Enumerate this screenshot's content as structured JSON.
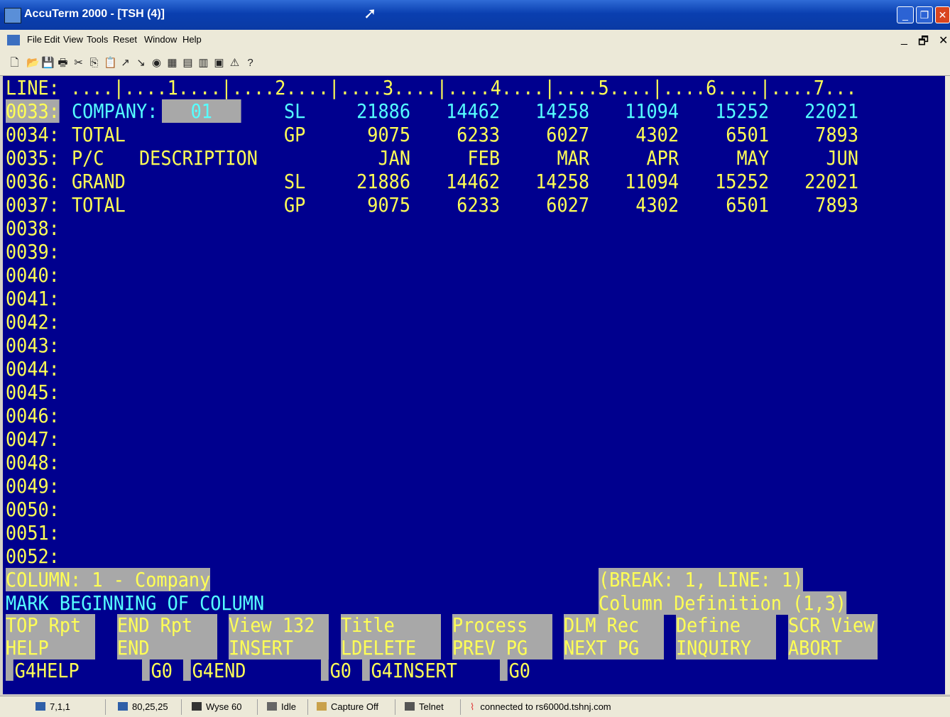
{
  "window": {
    "title": "AccuTerm 2000 - [TSH (4)]",
    "buttons": {
      "minimize": "_",
      "restore": "❐",
      "close": "✕"
    }
  },
  "menu": {
    "items": [
      "File",
      "Edit",
      "View",
      "Tools",
      "Reset",
      "Window",
      "Help"
    ],
    "mdi": {
      "minimize": "_",
      "restore": "🗗",
      "close": "✕"
    }
  },
  "toolbar": {
    "icons": [
      "new-icon",
      "open-icon",
      "save-icon",
      "print-icon",
      "cut-icon",
      "copy-icon",
      "paste-icon",
      "upload-icon",
      "download-icon",
      "capture-icon",
      "record-icon",
      "playback-icon",
      "printer-icon",
      "script-icon",
      "scan-icon",
      "help-icon"
    ],
    "glyphs": [
      "🗋",
      "📂",
      "💾",
      "🖶",
      "✂",
      "⎘",
      "📋",
      "↗",
      "↘",
      "◉",
      "▦",
      "▤",
      "▥",
      "▣",
      "⚠",
      "?"
    ]
  },
  "terminal": {
    "ruler": "LINE: ....|....1....|....2....|....3....|....4....|....5....|....6....|....7...",
    "rows": [
      {
        "line": "0033:",
        "c1": "COMPANY:",
        "c1b": "01",
        "code": "SL",
        "v": [
          "21886",
          "14462",
          "14258",
          "11094",
          "15252",
          "22021"
        ]
      },
      {
        "line": "0034:",
        "c1": "TOTAL",
        "code": "GP",
        "v": [
          "9075",
          "6233",
          "6027",
          "4302",
          "6501",
          "7893"
        ]
      },
      {
        "line": "0035:",
        "c1": "P/C",
        "c1c": "DESCRIPTION",
        "code": "",
        "v": [
          "JAN",
          "FEB",
          "MAR",
          "APR",
          "MAY",
          "JUN"
        ]
      },
      {
        "line": "0036:",
        "c1": "GRAND",
        "code": "SL",
        "v": [
          "21886",
          "14462",
          "14258",
          "11094",
          "15252",
          "22021"
        ]
      },
      {
        "line": "0037:",
        "c1": "TOTAL",
        "code": "GP",
        "v": [
          "9075",
          "6233",
          "6027",
          "4302",
          "6501",
          "7893"
        ]
      }
    ],
    "empty_lines": [
      "0038:",
      "0039:",
      "0040:",
      "0041:",
      "0042:",
      "0043:",
      "0044:",
      "0045:",
      "0046:",
      "0047:",
      "0048:",
      "0049:",
      "0050:",
      "0051:",
      "0052:"
    ],
    "status": {
      "column": "COLUMN: 1 - Company",
      "break": "(BREAK: 1, LINE: 1)",
      "mark": "MARK BEGINNING OF COLUMN",
      "definition": "Column Definition (1,3)"
    },
    "function_keys": [
      {
        "top": "TOP Rpt",
        "bottom": "HELP"
      },
      {
        "top": "END Rpt",
        "bottom": "END"
      },
      {
        "top": "View 132",
        "bottom": "INSERT"
      },
      {
        "top": "Title",
        "bottom": "LDELETE"
      },
      {
        "top": "Process",
        "bottom": "PREV PG"
      },
      {
        "top": "DLM Rec",
        "bottom": "NEXT PG"
      },
      {
        "top": "Define",
        "bottom": "INQUIRY"
      },
      {
        "top": "SCR View",
        "bottom": "ABORT"
      }
    ],
    "g4_line": [
      "G4HELP",
      "G0",
      "G4END",
      "G0",
      "G4INSERT",
      "G0"
    ]
  },
  "statusbar": {
    "cursor": "7,1,1",
    "size": "80,25,25",
    "emulation": "Wyse 60",
    "printer": "Idle",
    "capture": "Capture Off",
    "protocol": "Telnet",
    "connection": "connected to rs6000d.tshnj.com"
  }
}
